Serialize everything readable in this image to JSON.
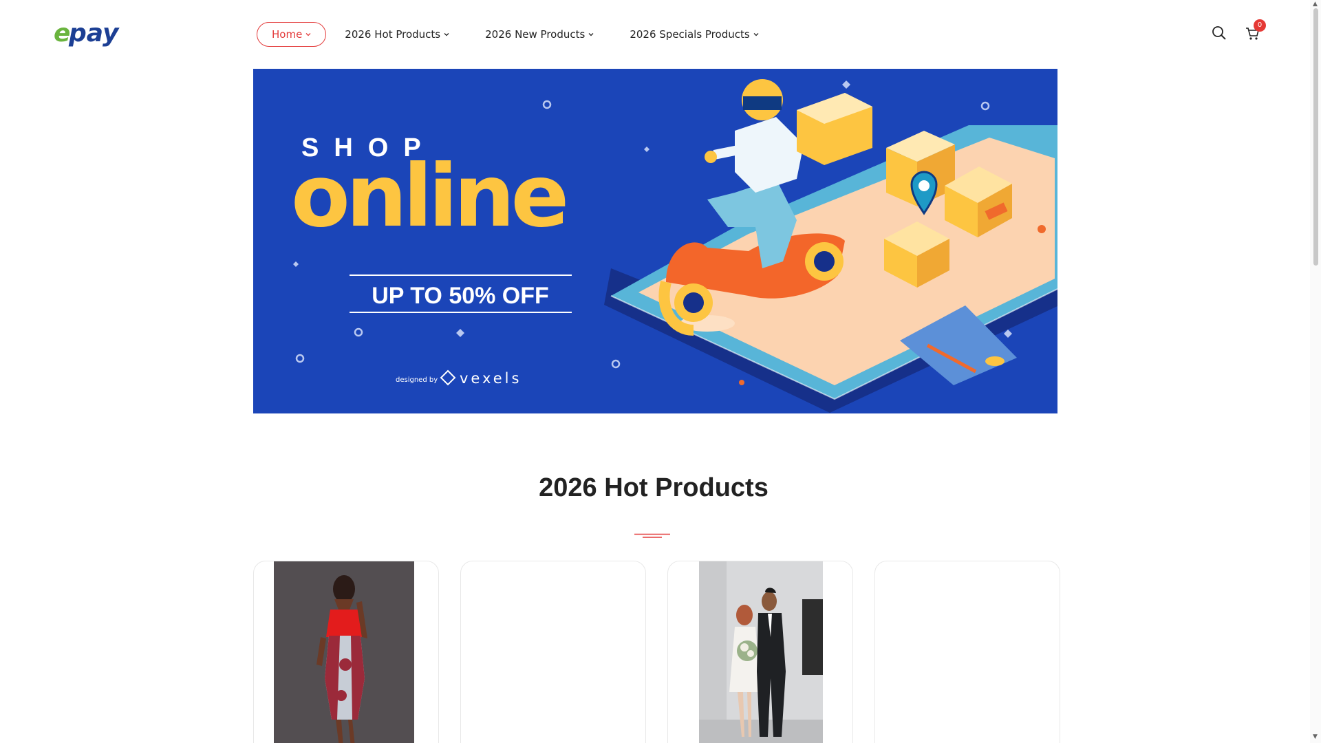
{
  "header": {
    "logo_text": "epay",
    "nav": [
      {
        "label": "Home",
        "active": true
      },
      {
        "label": "2026 Hot Products"
      },
      {
        "label": "2026 New Products"
      },
      {
        "label": "2026 Specials Products"
      }
    ],
    "cart_count": "0",
    "icons": [
      "search-icon",
      "cart-icon"
    ]
  },
  "banner": {
    "kicker": "SHOP",
    "headline": "online",
    "offer": "UP TO 50% OFF",
    "credit_prefix": "designed by",
    "credit_brand": "vexels",
    "colors": {
      "background": "#1b45b8",
      "accent": "#fdc541"
    }
  },
  "section": {
    "title_year": "2026",
    "title_rest": "Hot Products"
  },
  "products": [
    {
      "image": "woman-in-printed-dress-photo"
    },
    {
      "image": ""
    },
    {
      "image": "wedding-couple-photo"
    },
    {
      "image": ""
    }
  ],
  "colors": {
    "accent_red": "#e33b3b",
    "logo_green": "#6ab43e",
    "logo_blue": "#1c3f94"
  }
}
